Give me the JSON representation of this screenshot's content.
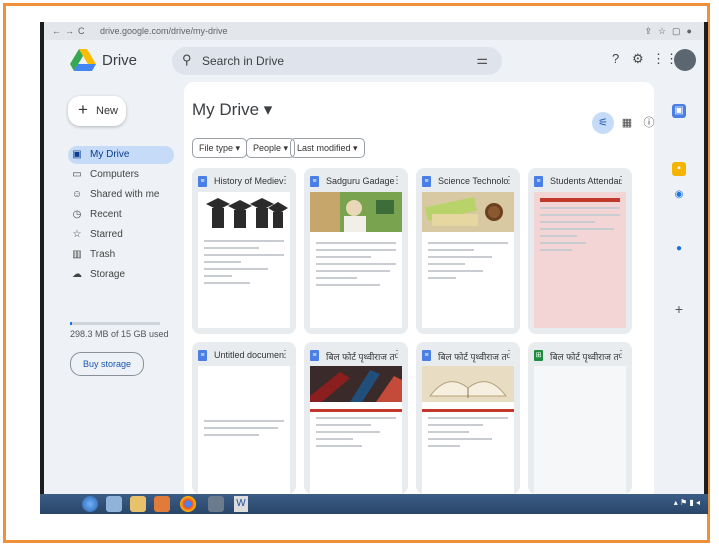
{
  "browser": {
    "url": "drive.google.com/drive/my-drive"
  },
  "app": {
    "brand": "Drive"
  },
  "search": {
    "placeholder": "Search in Drive"
  },
  "sidebar": {
    "new_label": "New",
    "items": [
      {
        "label": "My Drive",
        "icon": "my-drive-icon",
        "active": true
      },
      {
        "label": "Computers",
        "icon": "computer-icon"
      },
      {
        "label": "Shared with me",
        "icon": "people-icon"
      },
      {
        "label": "Recent",
        "icon": "clock-icon"
      },
      {
        "label": "Starred",
        "icon": "star-icon"
      },
      {
        "label": "Trash",
        "icon": "trash-icon"
      },
      {
        "label": "Storage",
        "icon": "cloud-icon"
      }
    ],
    "storage_used_fraction": 0.02,
    "storage_text": "298.3 MB of 15 GB used",
    "buy_storage_label": "Buy storage"
  },
  "main": {
    "title": "My Drive",
    "filters": [
      "File type",
      "People",
      "Last modified"
    ],
    "files": [
      {
        "name": "History of Medieval ...",
        "type": "docs"
      },
      {
        "name": "Sadguru Gadage M...",
        "type": "docs"
      },
      {
        "name": "Science Technolog...",
        "type": "docs"
      },
      {
        "name": "Students Attendanc...",
        "type": "docs"
      },
      {
        "name": "Untitled document",
        "type": "docs"
      },
      {
        "name": "बिल फोर्ट पृथ्वीराज तप...",
        "type": "docs"
      },
      {
        "name": "बिल फोर्ट पृथ्वीराज तप...",
        "type": "docs"
      },
      {
        "name": "बिल फोर्ट पृथ्वीराज तप...",
        "type": "sheets"
      }
    ]
  },
  "colors": {
    "frame": "#f0913a",
    "accent": "#1a73e8",
    "docs": "#4a7fe8",
    "sheets": "#1e8e3e"
  }
}
